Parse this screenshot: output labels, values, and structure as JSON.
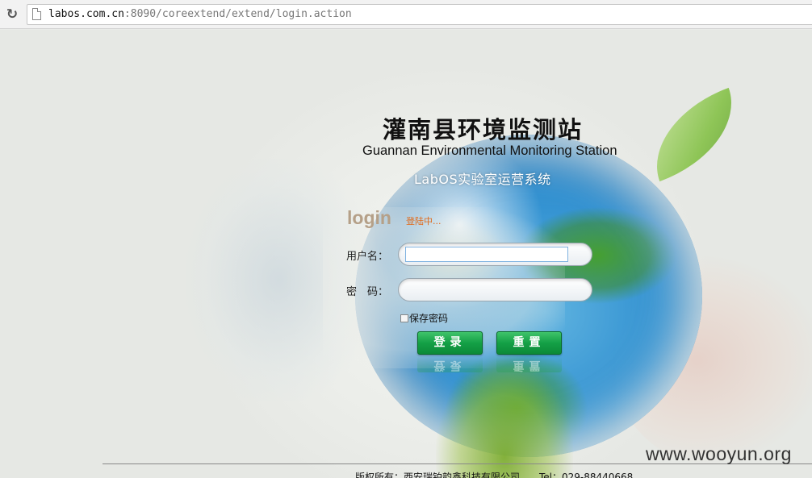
{
  "browser": {
    "url_host": "labos.com.cn",
    "url_rest": ":8090/coreextend/extend/login.action"
  },
  "header": {
    "title_cn": "灌南县环境监测站",
    "title_en": "Guannan Environmental Monitoring Station",
    "subtitle": "LabOS实验室运营系统"
  },
  "login": {
    "heading": "login",
    "status": "登陆中...",
    "username_label": "用户名：",
    "username_value": "",
    "password_label": "密　码：",
    "password_value": "",
    "remember_label": "保存密码",
    "remember_checked": false,
    "submit_label": "登录",
    "reset_label": "重置"
  },
  "footer": {
    "copyright": "版权所有：西安瑞铂韵鑫科技有限公司　　Tel：029-88440668"
  },
  "watermark": "www.wooyun.org",
  "colors": {
    "button_green": "#14a046",
    "status_orange": "#e06a1a",
    "login_heading": "#b5a088"
  }
}
